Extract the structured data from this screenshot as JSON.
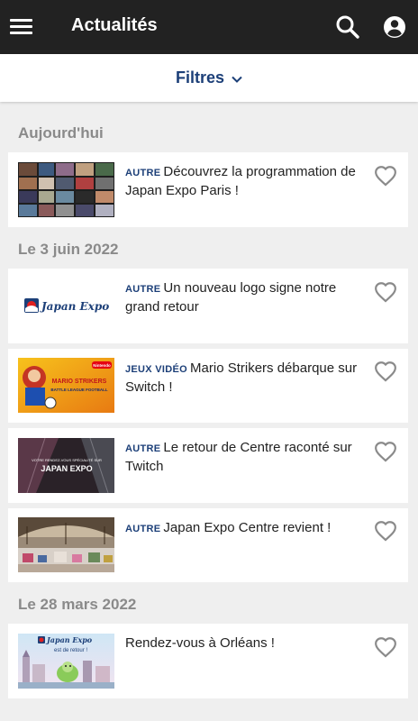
{
  "app": {
    "title": "Actualités",
    "menu_icon": "menu-icon",
    "search_icon": "search-icon",
    "account_icon": "account-circle-icon"
  },
  "filters": {
    "label": "Filtres",
    "icon": "chevron-down-icon"
  },
  "sections": [
    {
      "title": "Aujourd'hui",
      "items": [
        {
          "category": "AUTRE",
          "text": "Découvrez la programmation de Japan Expo Paris !",
          "thumbnail": "video-grid-collage",
          "favorite": false
        }
      ]
    },
    {
      "title": "Le 3 juin 2022",
      "items": [
        {
          "category": "AUTRE",
          "text": "Un nouveau logo signe notre grand retour",
          "thumbnail": "japan-expo-logo",
          "favorite": false
        },
        {
          "category": "JEUX VIDÉO",
          "text": "Mario Strikers débarque sur Switch !",
          "thumbnail": "mario-strikers-art",
          "favorite": false
        },
        {
          "category": "AUTRE",
          "text": "Le retour de Centre raconté sur Twitch",
          "thumbnail": "japan-expo-twitch-banner",
          "favorite": false
        },
        {
          "category": "AUTRE",
          "text": "Japan Expo Centre revient !",
          "thumbnail": "convention-hall-photo",
          "favorite": false
        }
      ]
    },
    {
      "title": "Le 28 mars 2022",
      "items": [
        {
          "category": "",
          "text": "Rendez-vous à Orléans !",
          "thumbnail": "japan-expo-est-de-retour-poster",
          "favorite": false
        }
      ]
    }
  ],
  "thumbnail_text": {
    "logo": "Japan Expo",
    "nintendo": "Nintendo",
    "mario_title": "MARIO STRIKERS",
    "mario_sub": "BATTLE LEAGUE FOOTBALL",
    "twitch_line1": "VOTRE RENDEZ-VOUS SPÉCIALITÉ SUR",
    "twitch_line2": "JAPAN EXPO",
    "orleans_logo": "Japan Expo",
    "orleans_sub": "est de retour !"
  },
  "colors": {
    "appbar": "#222222",
    "accent": "#1c3f78",
    "section_header": "#8a8a8a",
    "background": "#efefef",
    "heart_outline": "#8a8a8a"
  }
}
